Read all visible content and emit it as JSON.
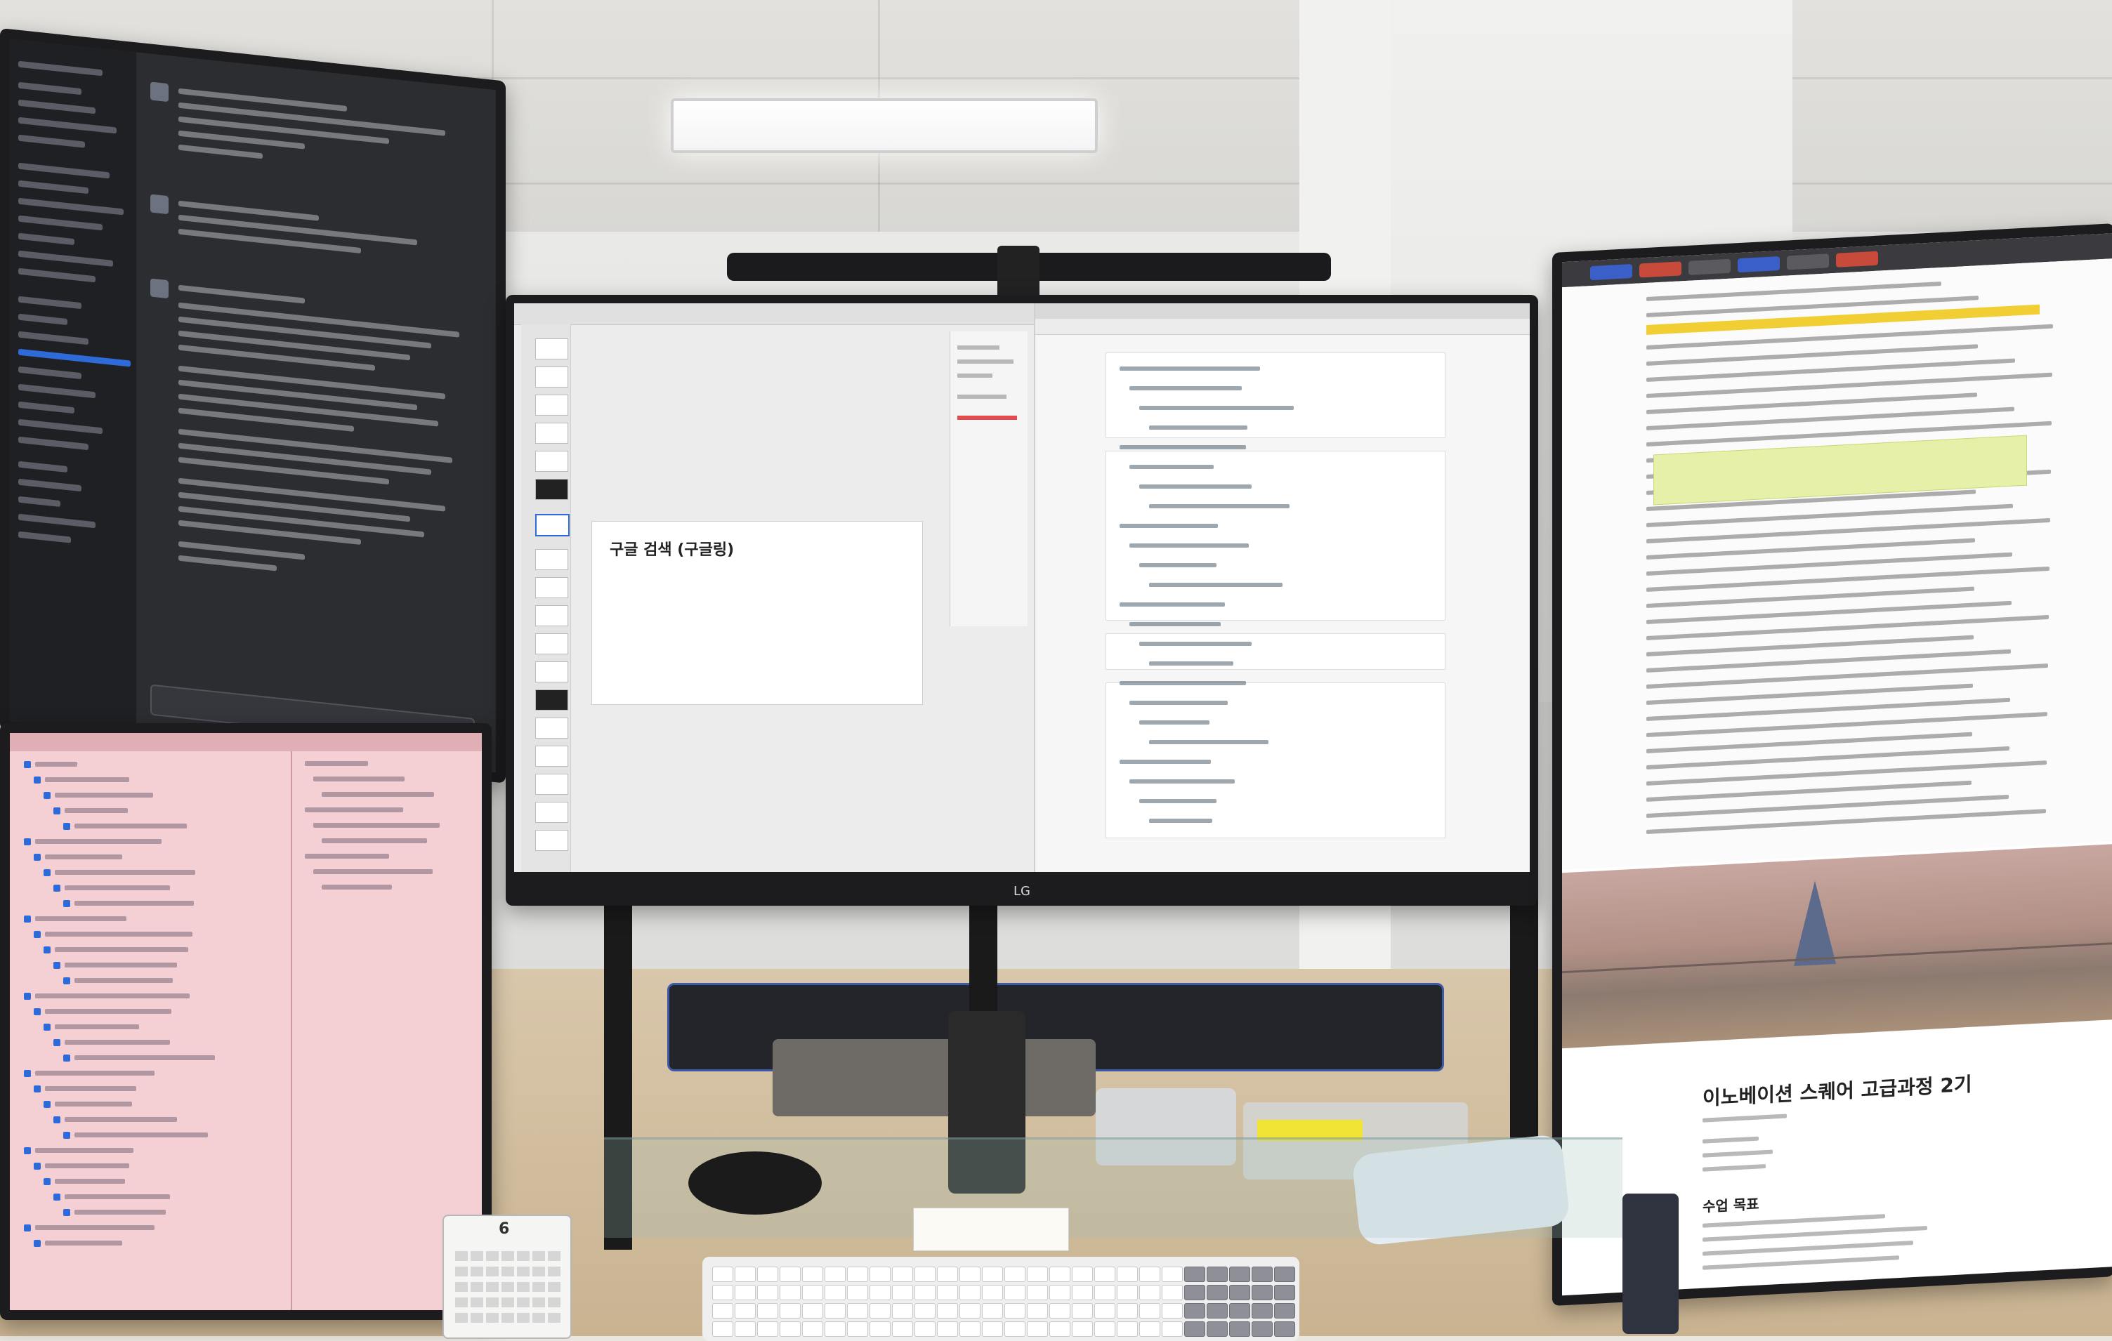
{
  "center_monitor": {
    "brand": "LG",
    "slide_title": "구글 검색 (구글링)"
  },
  "right_monitor": {
    "page_title": "이노베이션 스퀘어 고급과정 2기",
    "section_heading": "수업 목표"
  },
  "calendar": {
    "month": "6"
  },
  "colors": {
    "chat_bg": "#2b2d31",
    "tree_bg": "#f4cfd3",
    "highlight": "#f1cf34",
    "code_bg": "#e6f0a9",
    "desk": "#d9c7ab"
  },
  "icons": [
    "chat-app-icon",
    "file-tree-icon",
    "browser-tab-icon"
  ]
}
